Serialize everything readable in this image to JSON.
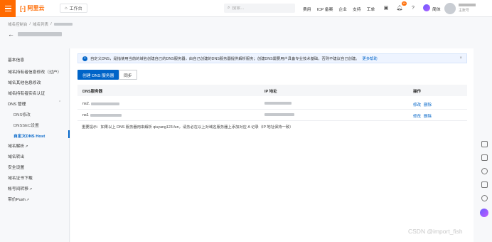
{
  "header": {
    "brand": "阿里云",
    "workbench_label": "工作台",
    "search_placeholder": "搜索...",
    "nav": [
      "费用",
      "ICP 备案",
      "企业",
      "支持",
      "工单"
    ],
    "notification_count": "19",
    "lang": "简体",
    "account_sub": "主账号"
  },
  "breadcrumb": [
    "域名控制台",
    "域名列表"
  ],
  "sidebar": {
    "items": [
      {
        "label": "基本信息"
      },
      {
        "label": "域名持有者信息修改（过户）"
      },
      {
        "label": "域名其他信息修改"
      },
      {
        "label": "域名持有者实名认证"
      },
      {
        "label": "DNS 管理"
      },
      {
        "label": "DNS修改"
      },
      {
        "label": "DNSSEC设置"
      },
      {
        "label": "自定义DNS Host"
      },
      {
        "label": "域名解析"
      },
      {
        "label": "域名转出"
      },
      {
        "label": "安全设置"
      },
      {
        "label": "域名证书下载"
      },
      {
        "label": "帐号间转移"
      },
      {
        "label": "带价Push"
      }
    ],
    "active_index": 7
  },
  "notice": {
    "text": "自定义DNS，是指使用当前的域名创建自己的DNS服务器，由自己创建的DNS服务器提供解析服务；创建DNS需要用户具备专业技术基础，否则不建议自己创建。",
    "link": "更多帮助"
  },
  "buttons": {
    "create": "创建 DNS 服务器",
    "sync": "同步"
  },
  "table": {
    "headers": [
      "DNS服务器",
      "IP 地址",
      "操作"
    ],
    "rows": [
      {
        "dns_prefix": "ns2.",
        "actions": [
          "修改",
          "删除"
        ]
      },
      {
        "dns_prefix": "ns1",
        "actions": [
          "修改",
          "删除"
        ]
      }
    ]
  },
  "tip": "重要提示：如果以上 DNS 服务器用来解析 qiuyang123.fun，请务必在以上对域名服务器上添加对应 A 记录（IP 地址保持一致）",
  "watermark": "CSDN @import_fish",
  "colors": {
    "brand": "#ff6a00",
    "primary": "#0064c8"
  }
}
